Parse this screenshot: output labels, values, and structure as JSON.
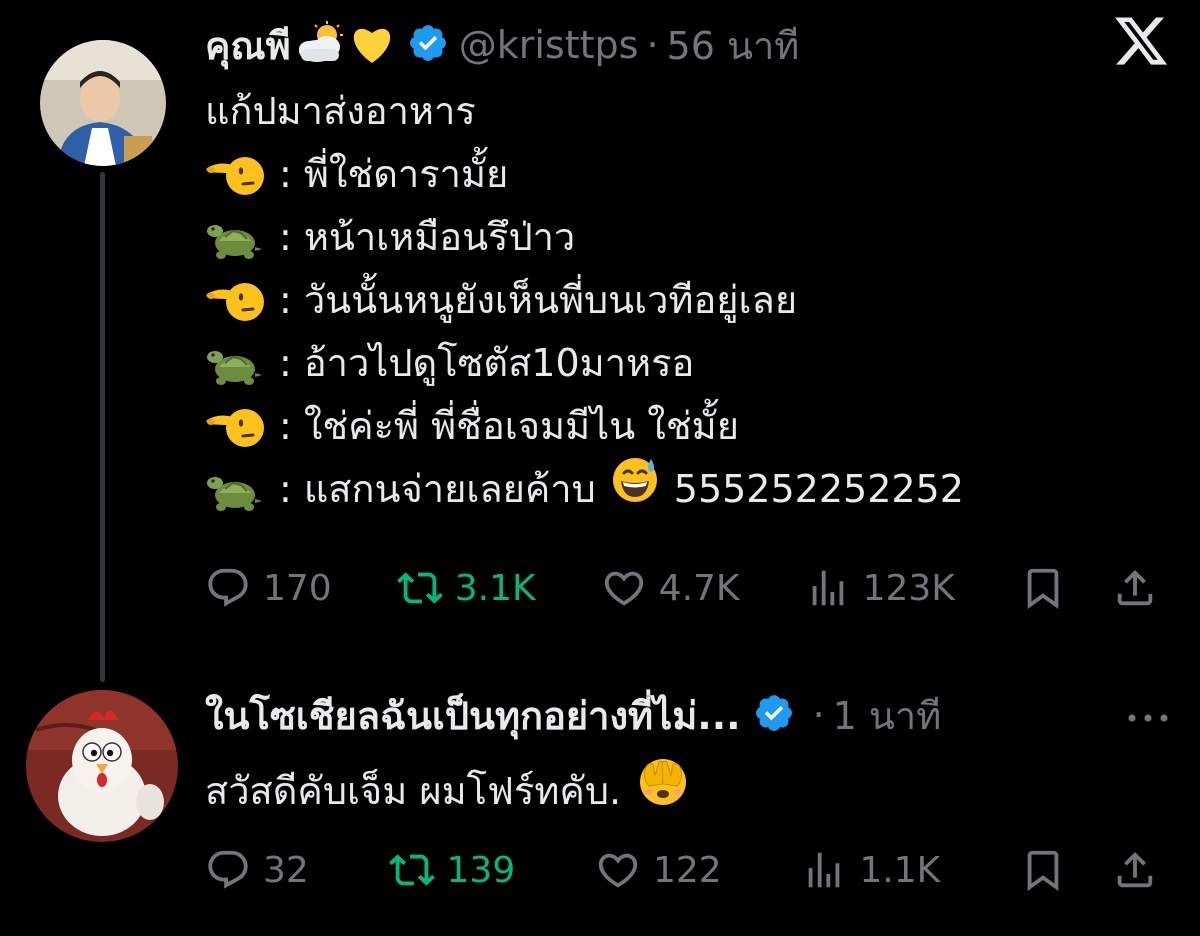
{
  "post": {
    "author_name": "คุณพี",
    "handle": "@kristtps",
    "separator": "·",
    "time": "56 นาที",
    "lines": [
      {
        "text": "แก้ปมาส่งอาหาร"
      },
      {
        "speaker": "pointing-face-icon",
        "text": "พี่ใช่ดารามั้ย"
      },
      {
        "speaker": "turtle-icon",
        "text": "หน้าเหมือนรึป่าว"
      },
      {
        "speaker": "pointing-face-icon",
        "text": "วันนั้นหนูยังเห็นพี่บนเวทีอยู่เลย"
      },
      {
        "speaker": "turtle-icon",
        "text": "อ้าวไปดูโซตัส10มาหรอ"
      },
      {
        "speaker": "pointing-face-icon",
        "text": "ใช่ค่ะพี่ พี่ชื่อเจมมีไน ใช่มั้ย"
      },
      {
        "speaker": "turtle-icon",
        "text": "แสกนจ่ายเลยค้าบ",
        "tail": "555252252252"
      }
    ],
    "colon": ":",
    "stats": {
      "replies": "170",
      "reposts": "3.1K",
      "likes": "4.7K",
      "views": "123K"
    }
  },
  "reply": {
    "author_name": "ในโซเชียลฉันเป็นทุกอย่างที่ไม่...",
    "separator": "·",
    "time": "1 นาที",
    "text": "สวัสดีคับเจ็ม ผมโฟร์ทคับ.",
    "stats": {
      "replies": "32",
      "reposts": "139",
      "likes": "122",
      "views": "1.1K"
    }
  },
  "colors": {
    "background": "#000000",
    "text": "#e7e9ea",
    "muted": "#71767b",
    "repost": "#00ba7c",
    "verified": "#1d9bf0"
  }
}
